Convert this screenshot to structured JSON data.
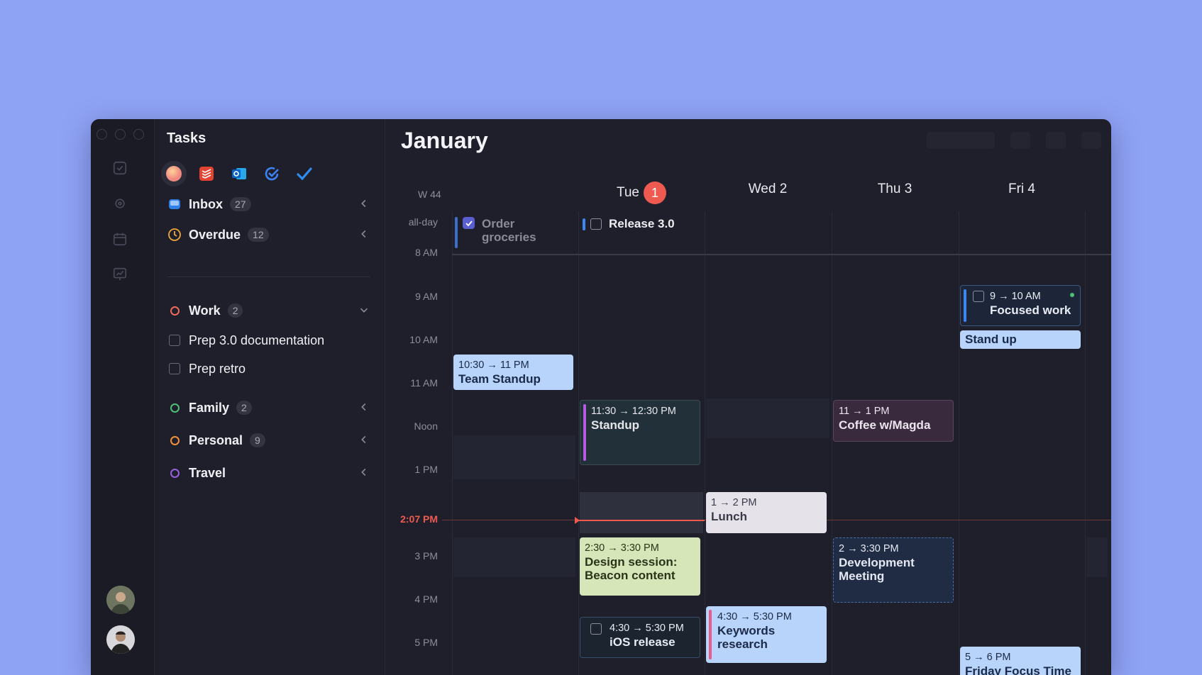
{
  "tasks": {
    "title": "Tasks",
    "lists": [
      {
        "label": "Inbox",
        "count": "27"
      },
      {
        "label": "Overdue",
        "count": "12"
      }
    ],
    "groups": [
      {
        "label": "Work",
        "count": "2",
        "color": "#ee6a5a",
        "items": [
          "Prep 3.0 documentation",
          "Prep retro"
        ]
      },
      {
        "label": "Family",
        "count": "2",
        "color": "#4fbf78"
      },
      {
        "label": "Personal",
        "count": "9",
        "color": "#f0913a"
      },
      {
        "label": "Travel",
        "count": "",
        "color": "#9b5fe0"
      }
    ]
  },
  "calendar": {
    "month": "January",
    "week": "W 44",
    "days": [
      {
        "label": "Tue",
        "number": "1",
        "today": true
      },
      {
        "label": "Wed 2"
      },
      {
        "label": "Thu 3"
      },
      {
        "label": "Fri 4"
      }
    ],
    "allday_label": "all-day",
    "allday": [
      {
        "name": "Order groceries",
        "done": true
      },
      {
        "name": "Release 3.0",
        "done": false
      }
    ],
    "hours": [
      "8 AM",
      "9 AM",
      "10 AM",
      "11 AM",
      "Noon",
      "1 PM",
      "3 PM",
      "4 PM",
      "5 PM"
    ],
    "now": "2:07 PM",
    "events": [
      {
        "time": "10:30 → 11 PM",
        "name": "Team Standup"
      },
      {
        "time": "11:30 → 12:30 PM",
        "name": "Standup"
      },
      {
        "time": "1 → 2 PM",
        "name": "Lunch"
      },
      {
        "time": "2:30 → 3:30 PM",
        "name": "Design session: Beacon content"
      },
      {
        "time": "4:30 → 5:30 PM",
        "name": "iOS release"
      },
      {
        "time": "4:30 → 5:30 PM",
        "name": "Keywords research"
      },
      {
        "time": "11 → 1 PM",
        "name": "Coffee w/Magda"
      },
      {
        "time": "2 → 3:30 PM",
        "name": "Development Meeting"
      },
      {
        "time": "9 → 10 AM",
        "name": "Focused work"
      },
      {
        "time": "",
        "name": "Stand up"
      },
      {
        "time": "5 → 6 PM",
        "name": "Friday Focus Time"
      }
    ]
  }
}
